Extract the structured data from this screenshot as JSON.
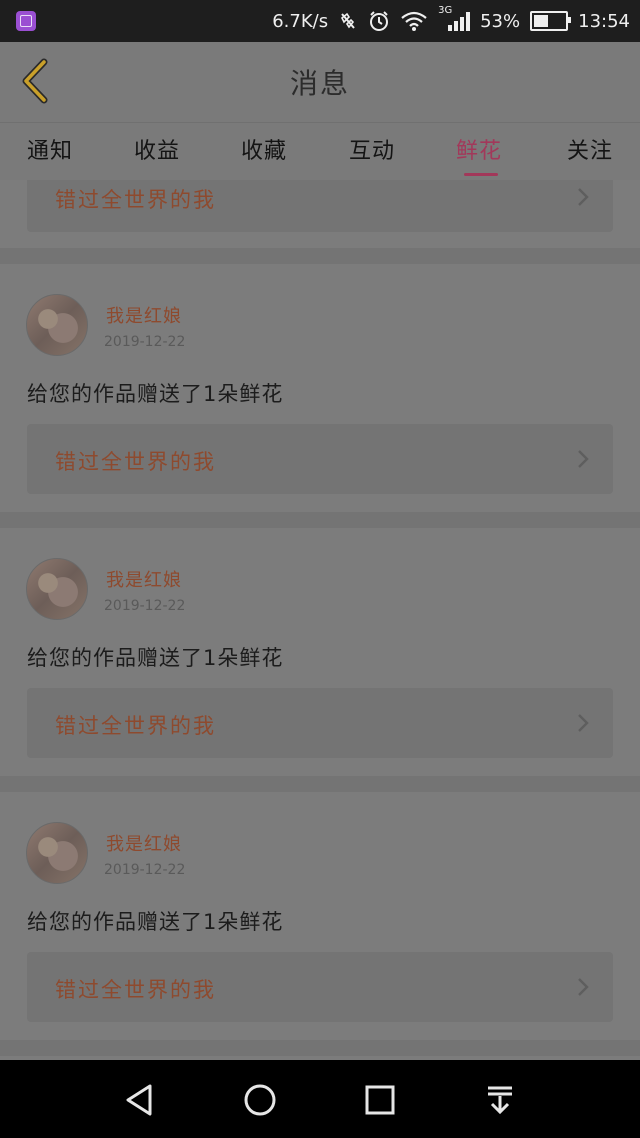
{
  "status_bar": {
    "speed": "6.7K/s",
    "network": "3G",
    "battery": "53%",
    "battery_level": 0.53,
    "time": "13:54"
  },
  "header": {
    "title": "消息"
  },
  "tabs": [
    {
      "label": "通知",
      "active": false
    },
    {
      "label": "收益",
      "active": false
    },
    {
      "label": "收藏",
      "active": false
    },
    {
      "label": "互动",
      "active": false
    },
    {
      "label": "鲜花",
      "active": true
    },
    {
      "label": "关注",
      "active": false
    }
  ],
  "items": [
    {
      "work_title": "错过全世界的我"
    },
    {
      "username": "我是红娘",
      "date": "2019-12-22",
      "message": "给您的作品赠送了1朵鲜花",
      "work_title": "错过全世界的我"
    },
    {
      "username": "我是红娘",
      "date": "2019-12-22",
      "message": "给您的作品赠送了1朵鲜花",
      "work_title": "错过全世界的我"
    },
    {
      "username": "我是红娘",
      "date": "2019-12-22",
      "message": "给您的作品赠送了1朵鲜花",
      "work_title": "错过全世界的我"
    }
  ],
  "colors": {
    "accent": "#a2385a",
    "name_color": "#8e4a2e",
    "back_arrow": "#c9a02a"
  },
  "icons": {
    "back": "chevron-left-icon",
    "nav_back": "triangle-back-icon",
    "nav_home": "circle-home-icon",
    "nav_recents": "square-recents-icon",
    "nav_notifications": "pull-down-icon"
  }
}
